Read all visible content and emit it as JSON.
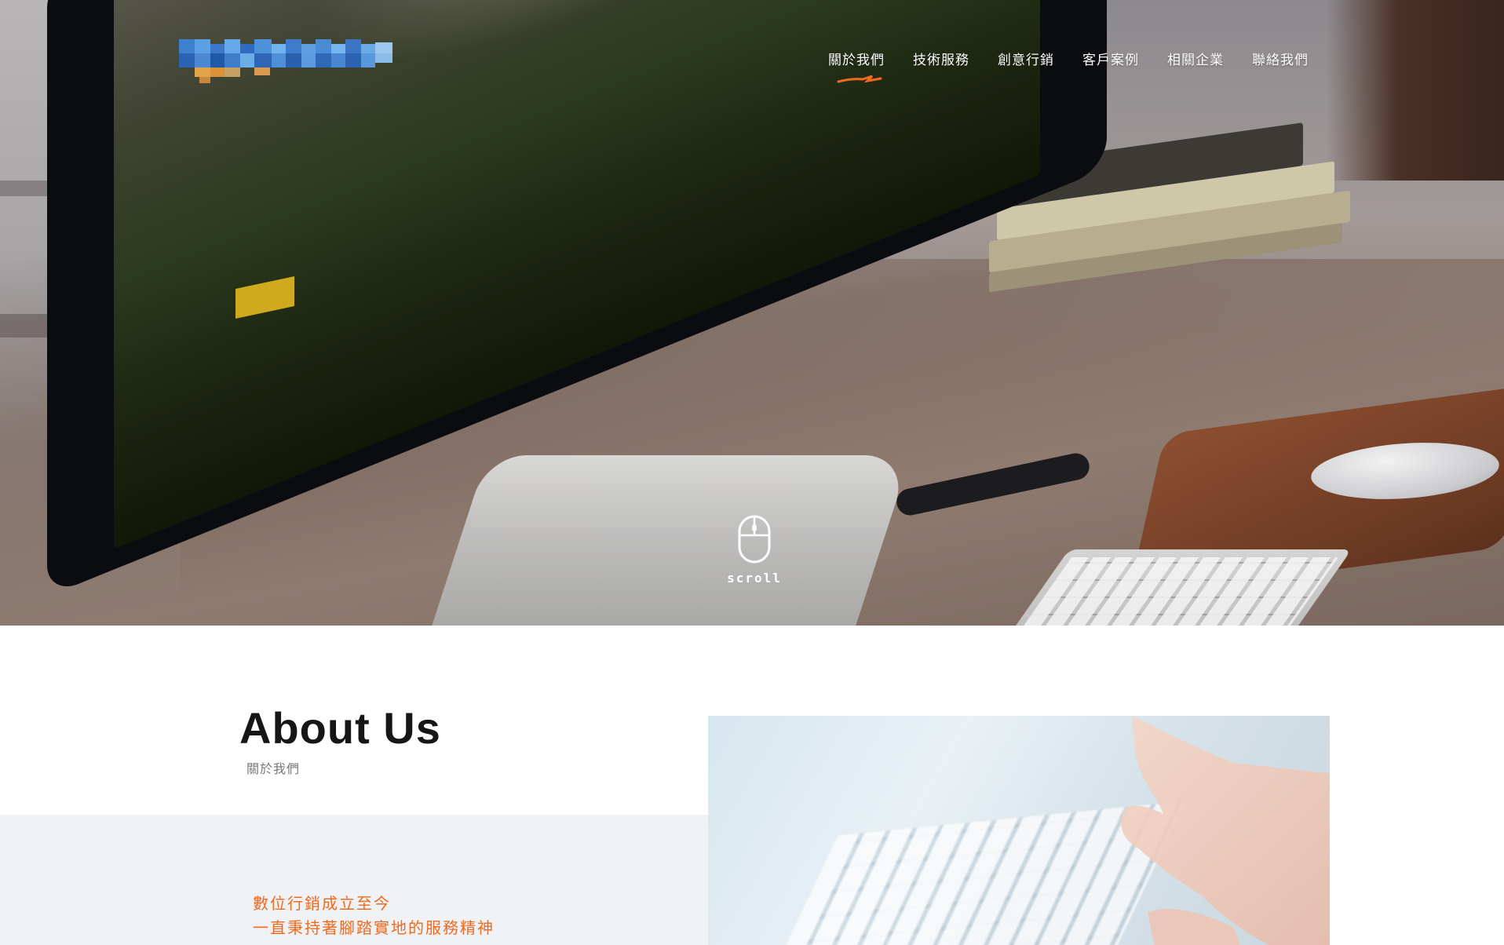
{
  "header": {
    "logo_alt": "logo",
    "nav": [
      {
        "label": "關於我們",
        "active": true
      },
      {
        "label": "技術服務",
        "active": false
      },
      {
        "label": "創意行銷",
        "active": false
      },
      {
        "label": "客戶案例",
        "active": false
      },
      {
        "label": "相關企業",
        "active": false
      },
      {
        "label": "聯絡我們",
        "active": false
      }
    ]
  },
  "hero": {
    "scroll_label": "scroll"
  },
  "about": {
    "title": "About Us",
    "subtitle": "關於我們",
    "lead_line1": "數位行銷成立至今",
    "lead_line2": "一直秉持著腳踏實地的服務精神"
  },
  "colors": {
    "accent": "#ef6a1e",
    "title": "#161616",
    "subtitle": "#777777",
    "section_bg": "#f1f2f5"
  },
  "icons": [
    "scroll-mouse-icon",
    "nav-active-underline-icon"
  ]
}
